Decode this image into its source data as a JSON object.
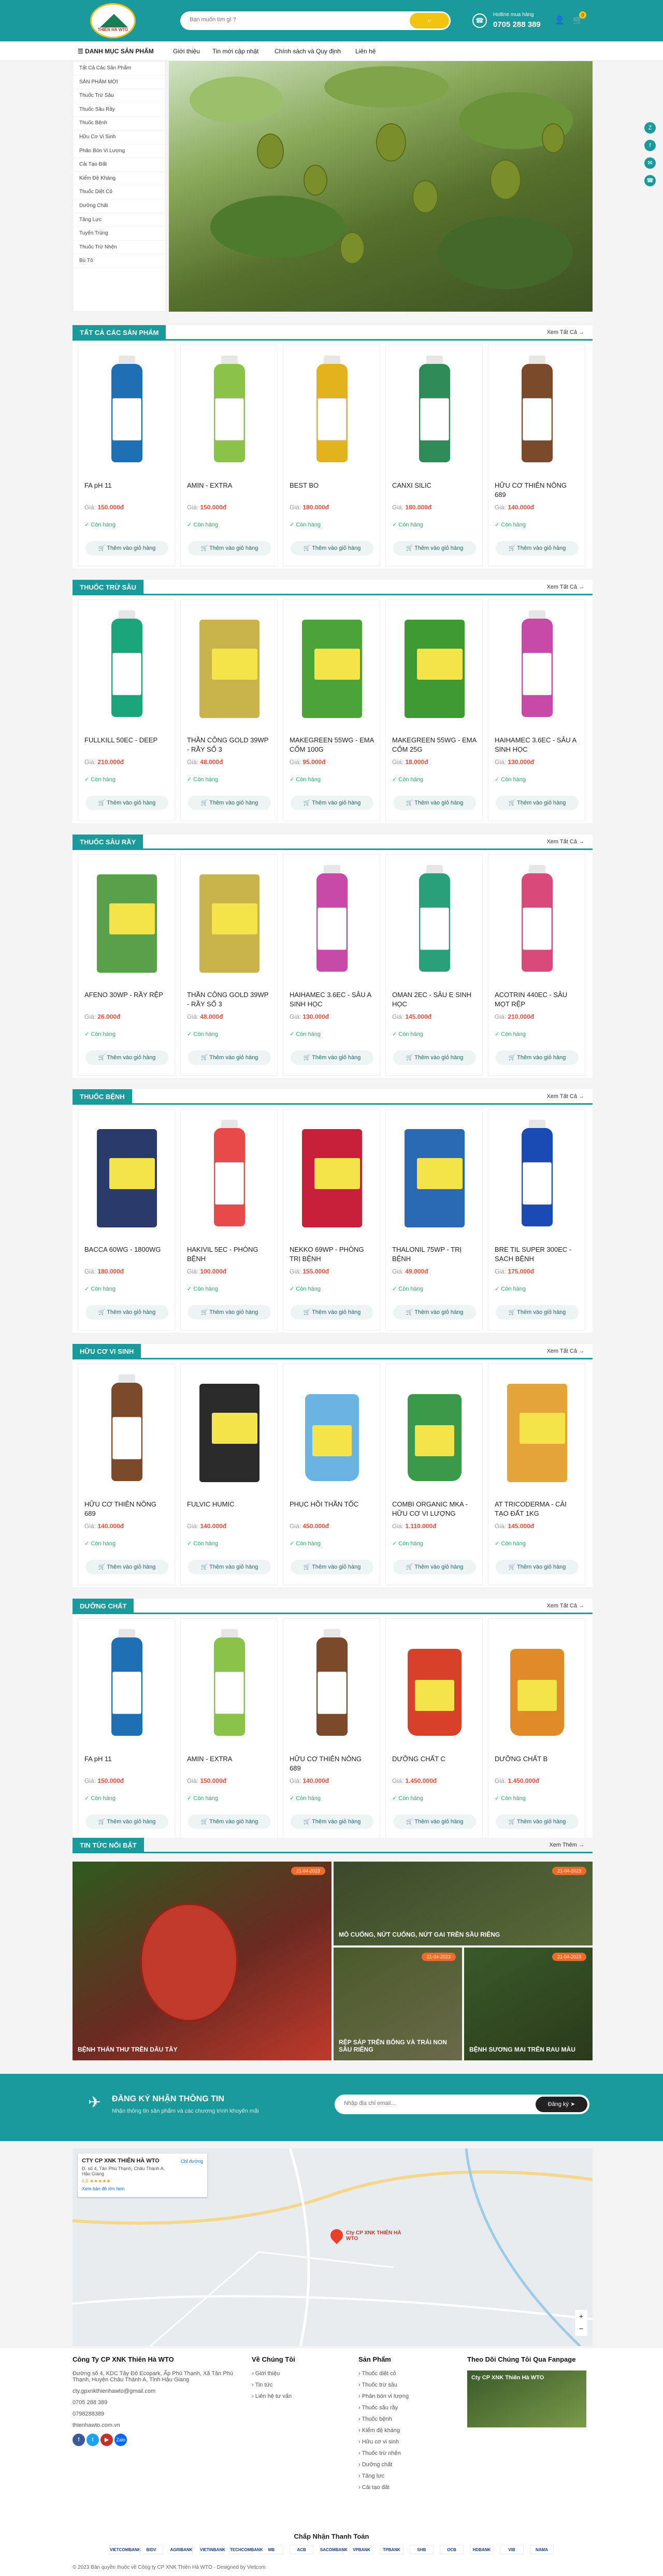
{
  "header": {
    "logo_text": "THIÊN HÀ WTO",
    "search_placeholder": "Bạn muốn tìm gì ?",
    "hotline_label": "Hotline mua hàng",
    "hotline": "0705 288 389",
    "cart_count": "0"
  },
  "nav": {
    "category_label": "DANH MỤC SẢN PHẨM",
    "links": [
      "Giới thiệu",
      "Tin mới cập nhật",
      "Chính sách và Quy định",
      "Liên hệ"
    ]
  },
  "sidebar": {
    "items": [
      "Tất Cả Các Sản Phẩm",
      "SẢN PHẨM MỚI",
      "Thuốc Trừ Sâu",
      "Thuốc Sâu Rầy",
      "Thuốc Bệnh",
      "Hữu Cơ Vi Sinh",
      "Phân Bón Vi Lượng",
      "Cải Tạo Đất",
      "Kiểm Đệ Kháng",
      "Thuốc Diệt Cỏ",
      "Dưỡng Chất",
      "Tăng Lực",
      "Tuyến Trùng",
      "Thuốc Trừ Nhện",
      "Bù Tô"
    ]
  },
  "common": {
    "price_label": "Giá:",
    "stock_label": "✓ Còn hàng",
    "add_to_cart": "🛒 Thêm vào giỏ hàng",
    "see_all": "Xem Tất Cả →"
  },
  "sections": [
    {
      "title": "TẤT CẢ CÁC SẢN PHẨM",
      "products": [
        {
          "name": "FA pH 11",
          "price": "150.000đ",
          "color": "#1f6fb5"
        },
        {
          "name": "AMIN - EXTRA",
          "price": "150.000đ",
          "color": "#8bc34a"
        },
        {
          "name": "BEST BO",
          "price": "180.000đ",
          "color": "#e2b31c"
        },
        {
          "name": "CANXI SILIC",
          "price": "180.000đ",
          "color": "#2e8b57"
        },
        {
          "name": "HỮU CƠ THIÊN NÔNG 689",
          "price": "140.000đ",
          "color": "#7a4a2a"
        }
      ]
    },
    {
      "title": "THUỐC TRỪ SÂU",
      "products": [
        {
          "name": "FULLKILL 50EC - DEEP",
          "price": "210.000đ",
          "color": "#1aa57a"
        },
        {
          "name": "THẦN CÔNG GOLD 39WP - RẦY SỐ 3",
          "price": "48.000đ",
          "color": "#c8b44a"
        },
        {
          "name": "MAKEGREEN 55WG - EMA CỐM 100G",
          "price": "95.000đ",
          "color": "#4ca33a"
        },
        {
          "name": "MAKEGREEN 55WG - EMA CỐM 25G",
          "price": "18.000đ",
          "color": "#3f9a34"
        },
        {
          "name": "HAIHAMEC 3.6EC - SÂU A SINH HỌC",
          "price": "130.000đ",
          "color": "#c84aa8"
        }
      ]
    },
    {
      "title": "THUỐC SÂU RẦY",
      "products": [
        {
          "name": "AFENO 30WP - RẦY RỆP",
          "price": "26.000đ",
          "color": "#5aa04a"
        },
        {
          "name": "THẦN CÔNG GOLD 39WP - RẦY SỐ 3",
          "price": "48.000đ",
          "color": "#c8b44a"
        },
        {
          "name": "HAIHAMEC 3.6EC - SÂU A SINH HỌC",
          "price": "130.000đ",
          "color": "#c84aa8"
        },
        {
          "name": "OMAN 2EC - SÂU E SINH HỌC",
          "price": "145.000đ",
          "color": "#2aa07a"
        },
        {
          "name": "ACOTRIN 440EC - SÂU MỌT RỆP",
          "price": "210.000đ",
          "color": "#d84a7a"
        }
      ]
    },
    {
      "title": "THUỐC BỆNH",
      "products": [
        {
          "name": "BACCA 60WG - 1800WG",
          "price": "180.000đ",
          "color": "#2a3a6a"
        },
        {
          "name": "HAKIVIL 5EC - PHÒNG BỆNH",
          "price": "100.000đ",
          "color": "#e84a4a"
        },
        {
          "name": "NEKKO 69WP - PHÒNG TRỊ BỆNH",
          "price": "155.000đ",
          "color": "#c8203a"
        },
        {
          "name": "THALONIL 75WP - TRỊ BỆNH",
          "price": "49.000đ",
          "color": "#2a6ab4"
        },
        {
          "name": "BRE TIL SUPER 300EC - SẠCH BỆNH",
          "price": "175.000đ",
          "color": "#1a4ab4"
        }
      ]
    },
    {
      "title": "HỮU CƠ VI SINH",
      "products": [
        {
          "name": "HỮU CƠ THIÊN NÔNG 689",
          "price": "140.000đ",
          "color": "#7a4a2a"
        },
        {
          "name": "FULVIC HUMIC",
          "price": "140.000đ",
          "color": "#2a2a2a"
        },
        {
          "name": "PHỤC HỒI THẦN TỐC",
          "price": "450.000đ",
          "color": "#6ab4e4"
        },
        {
          "name": "COMBI ORGANIC MKA - HỮU CƠ VI LƯỢNG",
          "price": "1.110.000đ",
          "color": "#3a9a4a"
        },
        {
          "name": "AT TRICODERMA - CẢI TẠO ĐẤT 1KG",
          "price": "145.000đ",
          "color": "#e4a43a"
        }
      ]
    },
    {
      "title": "DƯỠNG CHẤT",
      "products": [
        {
          "name": "FA pH 11",
          "price": "150.000đ",
          "color": "#1f6fb5"
        },
        {
          "name": "AMIN - EXTRA",
          "price": "150.000đ",
          "color": "#8bc34a"
        },
        {
          "name": "HỮU CƠ THIÊN NÔNG 689",
          "price": "140.000đ",
          "color": "#7a4a2a"
        },
        {
          "name": "DƯỠNG CHẤT C",
          "price": "1.450.000đ",
          "color": "#d8402a"
        },
        {
          "name": "DƯỠNG CHẤT B",
          "price": "1.450.000đ",
          "color": "#e08a2a"
        }
      ]
    }
  ],
  "news": {
    "title": "TIN TỨC NỔI BẬT",
    "see_all": "Xem Thêm →",
    "items": [
      {
        "title": "BỆNH THÁN THƯ TRÊN DÂU TÂY",
        "date": "21-04-2023"
      },
      {
        "title": "MÔ CUỐNG, NỨT CUỐNG, NỨT GAI TRÊN SẦU RIÊNG",
        "date": "21-04-2023"
      },
      {
        "title": "RỆP SÁP TRÊN BÔNG VÀ TRÁI NON SẦU RIÊNG",
        "date": "21-04-2023"
      },
      {
        "title": "BỆNH SƯƠNG MAI TRÊN RAU MÀU",
        "date": "21-04-2023"
      }
    ]
  },
  "newsletter": {
    "title": "ĐĂNG KÝ NHẬN THÔNG TIN",
    "subtitle": "Nhận thông tin sản phẩm và các chương trình khuyến mãi",
    "placeholder": "Nhập địa chỉ email...",
    "button": "Đăng ký"
  },
  "map": {
    "place": "CTY CP XNK THIÊN HÀ WTO",
    "address": "Đ. số 4, Tân Phú Thạnh, Châu Thành A, Hậu Giang",
    "rating": "5,0 ★★★★★",
    "directions": "Chỉ đường",
    "marker": "Cty CP XNK THIÊN HÀ WTO",
    "view_larger": "Xem bản đồ lớn hơn"
  },
  "footer": {
    "company": "Công Ty CP XNK Thiên Hà WTO",
    "address": "Đường số 4, KDC Tây Đô Ecopark, Ấp Phú Thạnh, Xã Tân Phú Thạnh, Huyện Châu Thành A, Tỉnh Hậu Giang",
    "email": "cty.gpxnkthienhawto@gmail.com",
    "phone1": "0705 288 389",
    "phone2": "0798288389",
    "web": "thienhawto.com.vn",
    "about_title": "Về Chúng Tôi",
    "about_links": [
      "Giới thiệu",
      "Tin tức",
      "Liên hệ tư vấn"
    ],
    "product_title": "Sản Phẩm",
    "product_links": [
      "Thuốc diệt cỏ",
      "Thuốc trừ sâu",
      "Phân bón vi lượng",
      "Thuốc sâu rầy",
      "Thuốc bệnh",
      "Kiểm đệ kháng",
      "Hữu cơ vi sinh",
      "Thuốc trừ nhện",
      "Dưỡng chất",
      "Tăng lực",
      "Cải tạo đất"
    ],
    "fanpage_title": "Theo Dõi Chúng Tôi Qua Fanpage",
    "fanpage_name": "Cty CP XNK Thiên Hà WTO",
    "payment_title": "Chấp Nhận Thanh Toán",
    "banks": [
      "VIETCOMBANK",
      "BIDV",
      "AGRIBANK",
      "VIETINBANK",
      "TECHCOMBANK",
      "MB",
      "ACB",
      "SACOMBANK",
      "VPBANK",
      "TPBANK",
      "SHB",
      "OCB",
      "HDBANK",
      "VIB",
      "NAMA"
    ],
    "copyright": "© 2023 Bản quyền thuộc về Công ty CP XNK Thiên Hà WTO - Designed by Vietcom"
  },
  "colors": {
    "primary": "#1a9a9a",
    "accent": "#f1c40f",
    "price": "#e74c3c",
    "stock": "#2eaa6a"
  }
}
